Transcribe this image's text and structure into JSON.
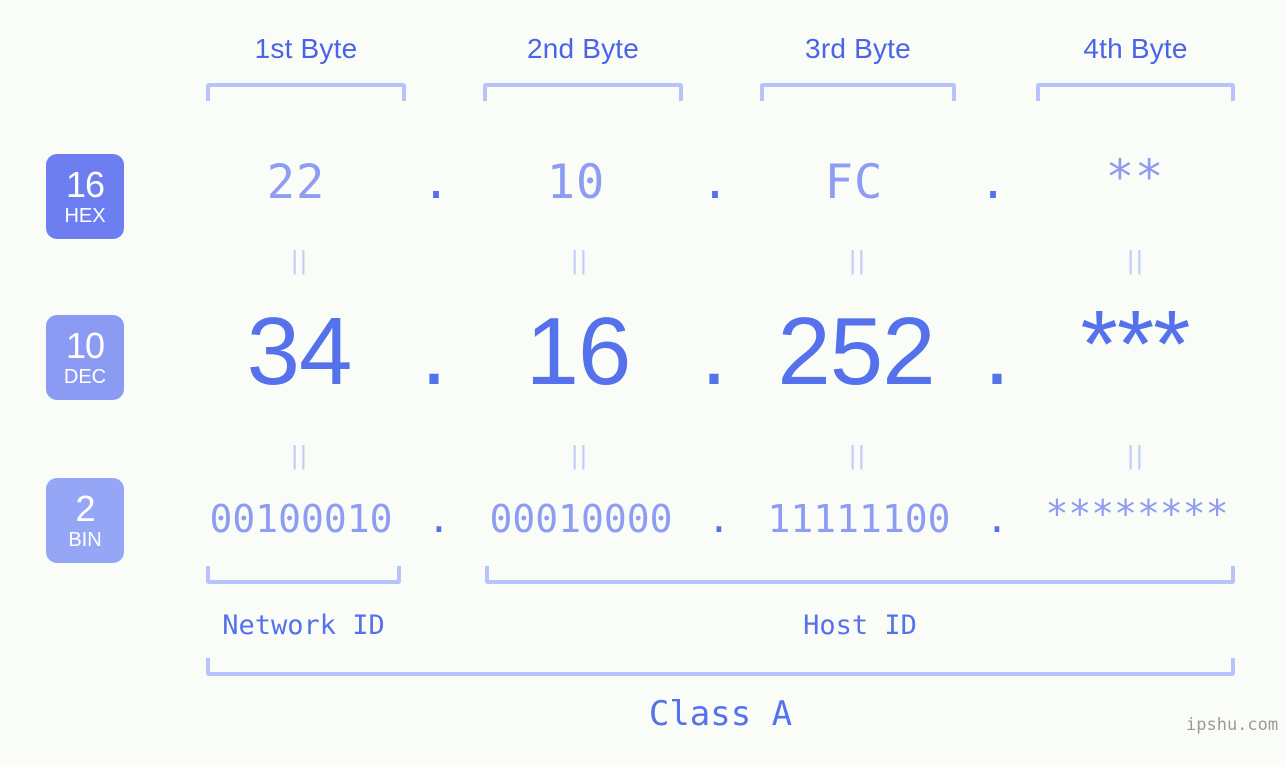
{
  "theme": {
    "background": "#fafdf7",
    "header_blue": "#4a63e7",
    "bracket_lavender": "#b9c3fb",
    "value_light": "#8e9cf3",
    "value_strong": "#5571ec",
    "equals_color": "#c3cbfb",
    "badge_hex": "#6c7ef0",
    "badge_dec": "#8b9bf4",
    "badge_bin": "#95a6f7",
    "watermark_gray": "#9a9a9a"
  },
  "byte_headers": [
    {
      "label": "1st Byte"
    },
    {
      "label": "2nd Byte"
    },
    {
      "label": "3rd Byte"
    },
    {
      "label": "4th Byte"
    }
  ],
  "radix_badges": [
    {
      "number": "16",
      "name": "HEX"
    },
    {
      "number": "10",
      "name": "DEC"
    },
    {
      "number": "2",
      "name": "BIN"
    }
  ],
  "rows": {
    "hex": {
      "values": [
        "22",
        "10",
        "FC",
        "**"
      ],
      "separators": [
        ".",
        ".",
        "."
      ]
    },
    "dec": {
      "values": [
        "34",
        "16",
        "252",
        "***"
      ],
      "separators": [
        ".",
        ".",
        "."
      ]
    },
    "bin": {
      "values": [
        "00100010",
        "00010000",
        "11111100",
        "********"
      ],
      "separators": [
        ".",
        ".",
        "."
      ]
    }
  },
  "equals": {
    "symbol": "||",
    "count_per_gap": 4
  },
  "segments": [
    {
      "label": "Network ID"
    },
    {
      "label": "Host ID"
    }
  ],
  "class_label": "Class A",
  "watermark": "ipshu.com"
}
